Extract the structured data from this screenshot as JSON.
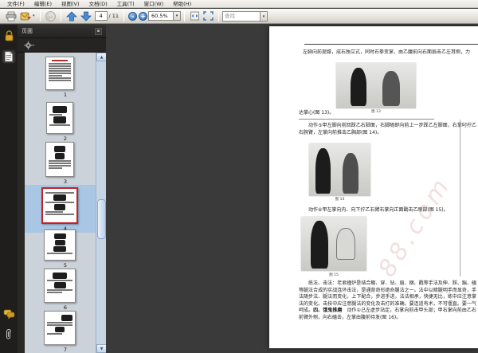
{
  "menubar": {
    "items": [
      {
        "label": "文件(F)"
      },
      {
        "label": "编辑(E)"
      },
      {
        "label": "视图(V)"
      },
      {
        "label": "文档(D)"
      },
      {
        "label": "工具(T)"
      },
      {
        "label": "窗口(W)"
      },
      {
        "label": "帮助(H)"
      }
    ]
  },
  "toolbar": {
    "page_number": "4",
    "page_total": "/ 11",
    "zoom_level": "60.5%",
    "find_placeholder": "查找",
    "zoom_out_glyph": "-",
    "zoom_in_glyph": "+",
    "caret_glyph": "▾",
    "icons": [
      "printer-icon",
      "share-icon",
      "disabled-tool-icon",
      "previous-page-icon",
      "next-page-icon",
      "zoom-out-icon",
      "zoom-in-icon",
      "fit-width-icon",
      "fit-page-icon"
    ]
  },
  "sidebar": {
    "panel_title": "页面",
    "options_button_glyph": "▪",
    "scroll_up_glyph": "▲",
    "scroll_down_glyph": "▼",
    "selected_page": 4,
    "thumbnails": [
      {
        "number": "1"
      },
      {
        "number": "2"
      },
      {
        "number": "3"
      },
      {
        "number": "4"
      },
      {
        "number": "5"
      },
      {
        "number": "6"
      },
      {
        "number": "7"
      }
    ]
  },
  "document": {
    "line1": "左脚向前提膝，成右独立式，同时右拳变掌，由乙腹前向右面扇击乙左耳侧，力",
    "line1_end": "达掌心(图 13)。",
    "figure13_caption": "图 13",
    "paragraph_action5": "动作⑤甲左脚向前回踩乙右脚面，右脚随即向前上一步踩乙左脚面，右掌叼拧乙右腕臂，左掌向前推击乙胸部(图 14)。",
    "figure14_caption": "图 14",
    "paragraph_action6": "动作⑥甲左掌向内、向下拧乙右臂右掌向正面戳击乙眼部(图 15)。",
    "figure15_caption": "图 15",
    "paragraph_method_a": "练法、击法：老君撞炉是结合棚、穿、钻、扇、捆、戳等手法及伸、踩、踹、磕等腿法合成的实战连环击法，是通背奇形绝命腿法之一。法中以暗腿明手而显奇，手法随步法、腿法而变化，上下配合，步进手进，法法相承，快捷无比，练中应注意掌法的变化。击技中应注意腿法的变化及击打的准确。要连追有术，不可僵直。要一气呵成。",
    "section_header": "四、饿鬼推磨",
    "paragraph_method_b": "　动作①己左虚步站定，右掌向前击甲头部；甲右掌向前由乙右前臂外侧，向右磕击，左掌由腹前待发(图 16)。",
    "watermark": "88.com"
  },
  "colors": {
    "selection_highlight": "#a9c6e4",
    "selected_thumb_border": "#c42127",
    "doc_background": "#3a3a3a",
    "nav_accent_blue": "#3f7fc4",
    "lock_gold": "#d9a427"
  }
}
